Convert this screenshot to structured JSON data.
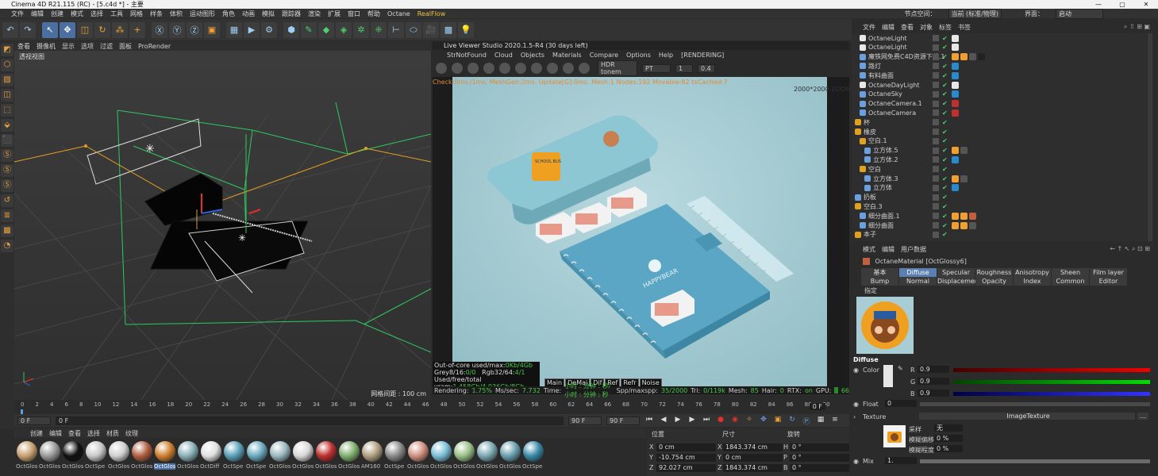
{
  "titlebar": {
    "title": "Cinema 4D R21.115 (RC) - [5.c4d *] - 主要",
    "min": "—",
    "max": "▢",
    "close": "✕"
  },
  "menubar": {
    "items": [
      "文件",
      "编辑",
      "创建",
      "模式",
      "选择",
      "工具",
      "网格",
      "样条",
      "体积",
      "运动图形",
      "角色",
      "动画",
      "模拟",
      "跟踪器",
      "渲染",
      "扩展",
      "窗口",
      "帮助",
      "Octane"
    ],
    "realflow": "RealFlow",
    "node_space_label": "节点空间：",
    "node_space_value": "当前 (标准/物理)",
    "layout_label": "界面：",
    "layout_value": "启动"
  },
  "viewport": {
    "menu": [
      "查看",
      "摄像机",
      "显示",
      "选项",
      "过滤",
      "面板",
      "ProRender"
    ],
    "label": "透视视图",
    "grid_spacing": "网格间距 : 100 cm",
    "axis_x": "X",
    "axis_y": "Y",
    "axis_z": "Z"
  },
  "live_viewer": {
    "title": "Live Viewer Studio 2020.1.5-R4 (30 days left)",
    "menu": [
      "StrNotFound",
      "Cloud",
      "Objects",
      "Materials",
      "Compare",
      "Options",
      "Help",
      "[RENDERING]"
    ],
    "mode": "HDR tonem",
    "kernel": "PT",
    "val1": "1",
    "val2": "0.4",
    "status_line": "Check:0ms./1ms. MeshGen:2ms. Update[G]:0ms. Mesh:1 Nodes:192 Movable:82 txCached:7",
    "resolution": "2000*2000 ZOOM:%4.6",
    "ooc_label": "Out-of-core used/max:",
    "ooc_val": "0Kb/4Gb",
    "grey_label": "Grey8/16:",
    "grey_val": "0/0",
    "rgb_label": "Rgb32/64:",
    "rgb_val": "4/1",
    "vram_label": "Used/free/total vram:",
    "vram_val": "1.458Gb/4.036Gb/8Gb",
    "buttons": [
      "Main",
      "DeMai",
      "Dif",
      "Ref",
      "Refr",
      "Noise"
    ],
    "bottom": {
      "rendering_label": "Rendering:",
      "rendering_val": "1.75%",
      "ms_label": "Ms/sec:",
      "ms_val": "7.732",
      "time_label": "Time:",
      "time_val": "小时 : 分钟 : 秒/小时 : 分钟 : 秒",
      "spp_label": "Spp/maxspp:",
      "spp_val": "35/2000",
      "tri_label": "Tri:",
      "tri_val": "0/119k",
      "mesh_label": "Mesh:",
      "mesh_val": "85",
      "hair_label": "Hair:",
      "hair_val": "0",
      "rtx_label": "RTX:",
      "rtx_val": "on",
      "gpu_label": "GPU:",
      "gpu_val": "66"
    },
    "render_texts": {
      "bus": "SCHOOL BUS",
      "notebook": "HAPPYBEAR"
    }
  },
  "timeline": {
    "ticks": [
      "0",
      "2",
      "4",
      "6",
      "8",
      "10",
      "12",
      "14",
      "16",
      "18",
      "20",
      "22",
      "24",
      "26",
      "28",
      "30",
      "32",
      "34",
      "36",
      "38",
      "40",
      "42",
      "44",
      "46",
      "48",
      "50",
      "52",
      "54",
      "56",
      "58",
      "60",
      "62",
      "64",
      "66",
      "68",
      "70",
      "72",
      "74",
      "76",
      "78",
      "80",
      "82",
      "84",
      "86",
      "88",
      "90"
    ],
    "end_frame": "0 F",
    "start": "0 F",
    "cur": "0 F",
    "max": "90 F",
    "max2": "90 F"
  },
  "materials": {
    "menu": [
      "创建",
      "编辑",
      "查看",
      "选择",
      "材质",
      "纹理"
    ],
    "items": [
      {
        "name": "OctGlos",
        "color": "#c8a070"
      },
      {
        "name": "OctGlos",
        "color": "#9a9a9a"
      },
      {
        "name": "OctGlos",
        "color": "#111111"
      },
      {
        "name": "OctSpe",
        "color": "#c8c8c8"
      },
      {
        "name": "OctGlos",
        "color": "#d0d0d0"
      },
      {
        "name": "OctGlos",
        "color": "#b06040"
      },
      {
        "name": "OctGlos",
        "color": "#d08030"
      },
      {
        "name": "OctGlos",
        "color": "#8ab0b8"
      },
      {
        "name": "OctDiff",
        "color": "#e0e0e0"
      },
      {
        "name": "OctSpe",
        "color": "#5aa0b8"
      },
      {
        "name": "OctSpe",
        "color": "#6aaac0"
      },
      {
        "name": "OctGlos",
        "color": "#9ab8c0"
      },
      {
        "name": "OctGlos",
        "color": "#d8d8d8"
      },
      {
        "name": "OctGlos",
        "color": "#c03030"
      },
      {
        "name": "OctGlos",
        "color": "#80b070"
      },
      {
        "name": "AM160",
        "color": "#b0a080"
      },
      {
        "name": "OctSpe",
        "color": "#8a8a8a"
      },
      {
        "name": "OctGlos",
        "color": "#d09080"
      },
      {
        "name": "OctGlos",
        "color": "#7ac0d8"
      },
      {
        "name": "OctGlos",
        "color": "#98c088"
      },
      {
        "name": "OctGlos",
        "color": "#7aa8b0"
      },
      {
        "name": "OctGlos",
        "color": "#6aa0b0"
      },
      {
        "name": "OctSpe",
        "color": "#3a8aa8"
      }
    ]
  },
  "coords": {
    "headers": [
      "位置",
      "尺寸",
      "旋转"
    ],
    "rows": [
      {
        "axis": "X",
        "pos": "0 cm",
        "size_axis": "X",
        "size": "1843.374 cm",
        "rot_axis": "H",
        "rot": "0 °"
      },
      {
        "axis": "Y",
        "pos": "-10.754 cm",
        "size_axis": "Y",
        "size": "0 cm",
        "rot_axis": "P",
        "rot": "0 °"
      },
      {
        "axis": "Z",
        "pos": "92.027 cm",
        "size_axis": "Z",
        "size": "1843.374 cm",
        "rot_axis": "B",
        "rot": "0 °"
      }
    ]
  },
  "object_manager": {
    "menu": [
      "文件",
      "编辑",
      "查看",
      "对象",
      "标签",
      "书签"
    ],
    "objects": [
      {
        "name": "OctaneLight",
        "indent": 1,
        "icon": "light"
      },
      {
        "name": "OctaneLight",
        "indent": 1,
        "icon": "light"
      },
      {
        "name": "魔铁网免费C4D资源下载.1",
        "indent": 1,
        "icon": "obj"
      },
      {
        "name": "路灯",
        "indent": 1,
        "icon": "obj"
      },
      {
        "name": "有料曲面",
        "indent": 1,
        "icon": "obj"
      },
      {
        "name": "OctaneDayLight",
        "indent": 1,
        "icon": "sun"
      },
      {
        "name": "OctaneSky",
        "indent": 1,
        "icon": "sky"
      },
      {
        "name": "OctaneCamera.1",
        "indent": 1,
        "icon": "cam"
      },
      {
        "name": "OctaneCamera",
        "indent": 1,
        "icon": "cam"
      },
      {
        "name": "杯",
        "indent": 0,
        "icon": "null"
      },
      {
        "name": "橡皮",
        "indent": 0,
        "icon": "null"
      },
      {
        "name": "空白.1",
        "indent": 1,
        "icon": "null"
      },
      {
        "name": "立方体.5",
        "indent": 2,
        "icon": "cube"
      },
      {
        "name": "立方体.2",
        "indent": 2,
        "icon": "cube"
      },
      {
        "name": "空白",
        "indent": 1,
        "icon": "null"
      },
      {
        "name": "立方体.3",
        "indent": 2,
        "icon": "cube"
      },
      {
        "name": "立方体",
        "indent": 2,
        "icon": "cube"
      },
      {
        "name": "扔板",
        "indent": 0,
        "icon": "obj"
      },
      {
        "name": "空白.3",
        "indent": 0,
        "icon": "null"
      },
      {
        "name": "细分曲面.1",
        "indent": 1,
        "icon": "obj"
      },
      {
        "name": "细分曲面",
        "indent": 1,
        "icon": "obj"
      },
      {
        "name": "本子",
        "indent": 0,
        "icon": "null"
      }
    ]
  },
  "attribute_manager": {
    "menu": [
      "模式",
      "编辑",
      "用户数据"
    ],
    "title": "OctaneMaterial [OctGlossy6]",
    "tabs_row1": [
      "基本",
      "Diffuse",
      "Specular",
      "Roughness",
      "Anisotropy",
      "Sheen layer",
      "Film layer"
    ],
    "tabs_row2": [
      "Bump",
      "Normal",
      "Displacement",
      "Opacity",
      "Index",
      "Common",
      "Editor"
    ],
    "sub": "指定",
    "section": "Diffuse",
    "color_label": "Color",
    "r_label": "R",
    "r_val": "0.9",
    "g_label": "G",
    "g_val": "0.9",
    "b_label": "B",
    "b_val": "0.9",
    "float_label": "Float",
    "float_val": "0",
    "texture_label": "Texture",
    "texture_val": "ImageTexture",
    "sampling_label": "采样",
    "sampling_val": "无",
    "blur_offset_label": "模糊偏移",
    "blur_offset_val": "0 %",
    "blur_scale_label": "模糊程度",
    "blur_scale_val": "0 %",
    "mix_label": "Mix",
    "mix_val": "1."
  },
  "colors": {
    "accent": "#4a6fa0",
    "green": "#4cd070",
    "orange": "#f0a030",
    "render_bg": "#a9cdd4"
  }
}
